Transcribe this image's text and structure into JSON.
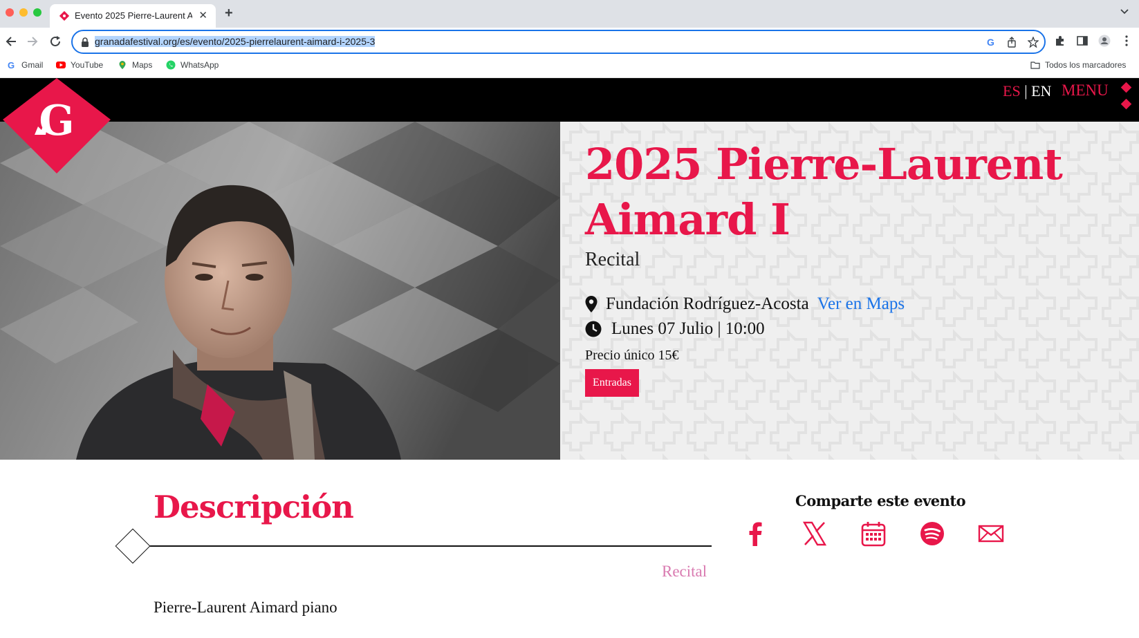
{
  "browser": {
    "tab_title": "Evento 2025 Pierre-Laurent Ai",
    "url_highlighted": "granadafestival.org/es/evento/2025-pierrelaurent-aimard-i-2025-3",
    "bookmarks": [
      {
        "label": "Gmail",
        "icon": "gmail-icon"
      },
      {
        "label": "YouTube",
        "icon": "youtube-icon"
      },
      {
        "label": "Maps",
        "icon": "maps-icon"
      },
      {
        "label": "WhatsApp",
        "icon": "whatsapp-icon"
      }
    ],
    "all_bookmarks": "Todos los marcadores"
  },
  "header": {
    "lang_es": "ES",
    "lang_sep": " | ",
    "lang_en": "EN",
    "menu": "MENU",
    "logo_icon": "granada-festival-logo"
  },
  "event": {
    "title": "2025 Pierre-Laurent Aimard I",
    "type": "Recital",
    "venue": "Fundación Rodríguez-Acosta",
    "maps_link": "Ver en Maps",
    "datetime": "Lunes 07 Julio | 10:00",
    "price": "Precio único 15€",
    "tickets_button": "Entradas"
  },
  "content": {
    "description_title": "Descripción",
    "tag": "Recital",
    "performer": "Pierre-Laurent Aimard piano"
  },
  "share": {
    "title": "Comparte este evento",
    "icons": [
      "facebook-icon",
      "x-icon",
      "calendar-icon",
      "spotify-icon",
      "mail-icon"
    ]
  },
  "colors": {
    "brand": "#e8174a",
    "link": "#1a73e8",
    "tag": "#d97ab0"
  }
}
